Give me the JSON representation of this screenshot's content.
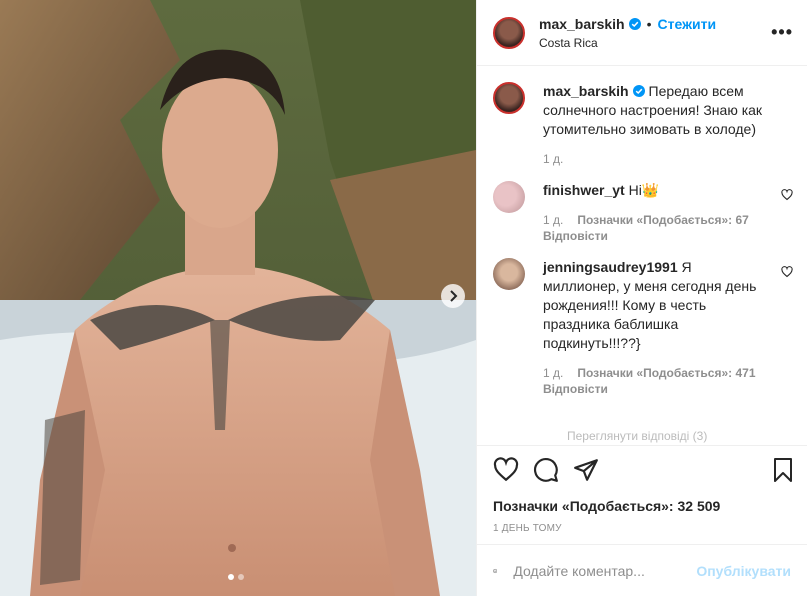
{
  "header": {
    "username": "max_barskih",
    "follow_label": "Стежити",
    "location": "Costa Rica",
    "more_label": "•••"
  },
  "caption": {
    "username": "max_barskih",
    "text": "Передаю всем солнечного настроения! Знаю как утомительно зимовать в холоде)",
    "time": "1 д."
  },
  "comments": [
    {
      "username": "finishwer_yt",
      "text": "Hi👑",
      "time": "1 д.",
      "likes": "Позначки «Подобається»: 67",
      "reply": "Відповісти"
    },
    {
      "username": "jenningsaudrey1991",
      "text": "Я миллионер, у меня сегодня день рождения!!! Кому в честь праздника баблишка подкинуть!!!??}",
      "time": "1 д.",
      "likes": "Позначки «Подобається»: 471",
      "reply": "Відповісти"
    }
  ],
  "more_comments_hint": "Переглянути відповіді (3)",
  "likes_total": "Позначки «Подобається»: 32 509",
  "time_ago": "1 ДЕНЬ ТОМУ",
  "comment_input": {
    "placeholder": "Додайте коментар...",
    "value": ""
  },
  "post_label": "Опублікувати",
  "carousel": {
    "slides": 2,
    "current": 1
  },
  "colors": {
    "accent": "#0095f6",
    "post_disabled": "#b2dffc",
    "muted": "#8e8e8e"
  }
}
